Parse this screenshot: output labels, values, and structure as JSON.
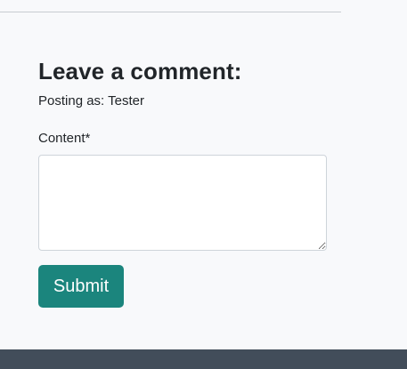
{
  "comment_form": {
    "heading": "Leave a comment:",
    "posting_as": "Posting as: Tester",
    "content_label": "Content*",
    "content_value": "",
    "submit_label": "Submit"
  },
  "colors": {
    "page_background": "#f8f9fb",
    "submit_button": "#1b857d",
    "footer": "#424d5a",
    "divider": "#c8ccd1"
  }
}
